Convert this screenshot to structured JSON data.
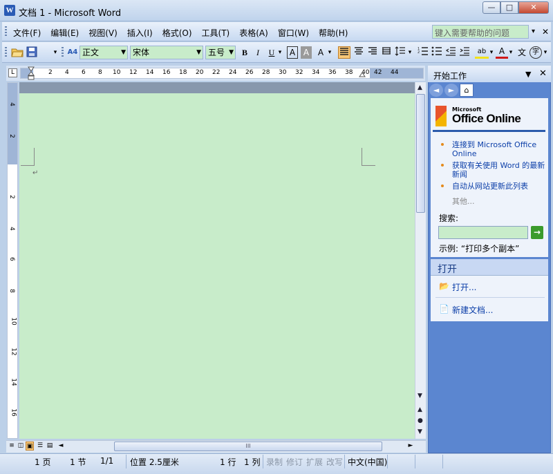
{
  "window": {
    "title": "文档 1 - Microsoft Word",
    "app_icon_letter": "W",
    "minimize": "—",
    "maximize": "□",
    "close": "✕"
  },
  "menu": {
    "items": [
      "文件(F)",
      "编辑(E)",
      "视图(V)",
      "插入(I)",
      "格式(O)",
      "工具(T)",
      "表格(A)",
      "窗口(W)",
      "帮助(H)"
    ],
    "help_placeholder": "键入需要帮助的问题",
    "help_dropdown": "▾",
    "close": "✕"
  },
  "toolbar": {
    "style_value": "正文",
    "font_value": "宋体",
    "size_value": "五号",
    "style_icon": "A4",
    "bold": "B",
    "italic": "I",
    "underline": "U",
    "char_border": "A",
    "char_shading": "A",
    "scale": "A",
    "highlight": "ab",
    "font_color": "A",
    "wen": "文",
    "phonetic": "字"
  },
  "ruler": {
    "corner": "L",
    "marks": [
      "2",
      "4",
      "6",
      "8",
      "10",
      "12",
      "14",
      "16",
      "18",
      "20",
      "22",
      "24",
      "26",
      "28",
      "30",
      "32",
      "34",
      "36",
      "38",
      "40",
      "42",
      "44"
    ],
    "vmarks": [
      "4",
      "2",
      "2",
      "4",
      "6",
      "8",
      "10",
      "12",
      "14",
      "16"
    ]
  },
  "document": {
    "paragraph_mark": "↵"
  },
  "scrollbar": {
    "grip": "III"
  },
  "taskpane": {
    "title": "开始工作",
    "dropdown": "▼",
    "close": "✕",
    "back": "◄",
    "forward": "►",
    "home": "⌂",
    "logo_brand": "Microsoft",
    "logo_text": "Office Online",
    "links": [
      "连接到 Microsoft Office Online",
      "获取有关使用 Word 的最新新闻",
      "自动从网站更新此列表"
    ],
    "more": "其他...",
    "search_label": "搜索:",
    "search_go": "→",
    "example": "示例: “打印多个副本”",
    "open_title": "打开",
    "open_items": [
      "打开...",
      "新建文档..."
    ]
  },
  "status": {
    "page": "1 页",
    "section": "1 节",
    "page_of": "1/1",
    "position": "位置 2.5厘米",
    "line": "1 行",
    "column": "1 列",
    "rec": "录制",
    "trk": "修订",
    "ext": "扩展",
    "ovr": "改写",
    "language": "中文(中国)"
  },
  "colors": {
    "document_bg": "#c8ecca",
    "pane_blue": "#5b86d0",
    "link": "#0b3ea8"
  }
}
